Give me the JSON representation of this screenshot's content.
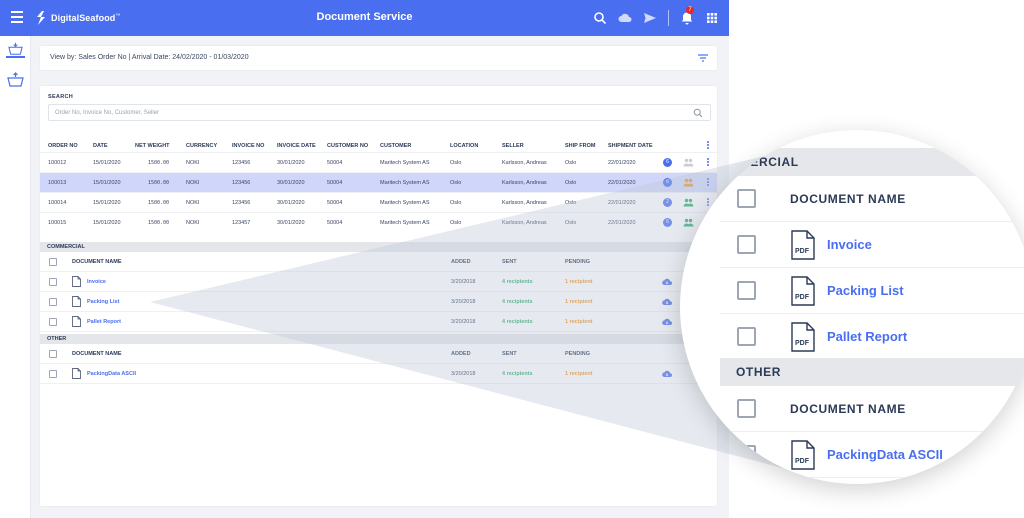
{
  "app": {
    "brand": "DigitalSeafood",
    "brand_tm": "™",
    "title": "Document Service",
    "notification_count": "7"
  },
  "viewby": {
    "text": "View by: Sales Order No | Arrival Date: 24/02/2020 - 01/03/2020"
  },
  "search": {
    "label": "SEARCH",
    "placeholder": "Order No, Invoice No, Customer, Seller"
  },
  "orders": {
    "headers": [
      "ORDER NO",
      "DATE",
      "NET WEIGHT",
      "CURRENCY",
      "INVOICE NO",
      "INVOICE DATE",
      "CUSTOMER NO",
      "CUSTOMER",
      "LOCATION",
      "SELLER",
      "SHIP FROM",
      "SHIPMENT DATE"
    ],
    "rows": [
      {
        "order_no": "100012",
        "date": "15/01/2020",
        "net_weight": "1500.00",
        "currency": "NOKI",
        "invoice_no": "123456",
        "invoice_date": "30/01/2020",
        "customer_no": "50004",
        "customer": "Maritech System AS",
        "location": "Oslo",
        "seller": "Karlsson, Andreas",
        "ship_from": "Oslo",
        "shipment_date": "22/01/2020",
        "docs": "6",
        "people_color": "#c8cdd6",
        "selected": false
      },
      {
        "order_no": "100013",
        "date": "15/01/2020",
        "net_weight": "1500.00",
        "currency": "NOKI",
        "invoice_no": "123456",
        "invoice_date": "30/01/2020",
        "customer_no": "50004",
        "customer": "Maritech System AS",
        "location": "Oslo",
        "seller": "Karlsson, Andreas",
        "ship_from": "Oslo",
        "shipment_date": "22/01/2020",
        "docs": "6",
        "people_color": "#f0941e",
        "selected": true
      },
      {
        "order_no": "100014",
        "date": "15/01/2020",
        "net_weight": "1500.00",
        "currency": "NOKI",
        "invoice_no": "123456",
        "invoice_date": "30/01/2020",
        "customer_no": "50004",
        "customer": "Maritech System AS",
        "location": "Oslo",
        "seller": "Karlsson, Andreas",
        "ship_from": "Oslo",
        "shipment_date": "22/01/2020",
        "docs": "2",
        "people_color": "#2eae6a",
        "selected": false
      },
      {
        "order_no": "100015",
        "date": "15/01/2020",
        "net_weight": "1500.00",
        "currency": "NOKI",
        "invoice_no": "123457",
        "invoice_date": "30/01/2020",
        "customer_no": "50004",
        "customer": "Maritech System AS",
        "location": "Oslo",
        "seller": "Karlsson, Andreas",
        "ship_from": "Oslo",
        "shipment_date": "22/01/2020",
        "docs": "6",
        "people_color": "#2eae6a",
        "selected": false
      }
    ]
  },
  "documents": {
    "commercial_label": "COMMERCIAL",
    "other_label": "OTHER",
    "col_name": "DOCUMENT NAME",
    "col_added": "ADDED",
    "col_sent": "SENT",
    "col_pending": "PENDING",
    "pdf_label": "PDF",
    "commercial": [
      {
        "name": "Invoice",
        "added": "3/20/2018",
        "sent": "4 recipients",
        "pending": "1 recipient"
      },
      {
        "name": "Packing List",
        "added": "3/20/2018",
        "sent": "4 recipients",
        "pending": "1 recipient"
      },
      {
        "name": "Pallet Report",
        "added": "3/20/2018",
        "sent": "4 recipients",
        "pending": "1 recipient"
      }
    ],
    "other": [
      {
        "name": "PackingData ASCII",
        "added": "3/20/2018",
        "sent": "4 recipients",
        "pending": "1 recipient"
      }
    ]
  },
  "magnifier": {
    "commercial_label": "COMMERCIAL",
    "other_label": "OTHER"
  },
  "colors": {
    "primary": "#4a6ef0",
    "selected_row": "#cfd6f9",
    "sent": "#2eae6a",
    "pending": "#f0941e",
    "notification": "#e02b2b"
  },
  "icons": [
    "menu-icon",
    "logo-icon",
    "search-icon",
    "cloud-download-icon",
    "send-icon",
    "bell-icon",
    "apps-icon",
    "basket-down-icon",
    "basket-up-icon",
    "filter-icon",
    "people-icon",
    "more-vert-icon",
    "pdf-file-icon",
    "checkbox-icon"
  ]
}
